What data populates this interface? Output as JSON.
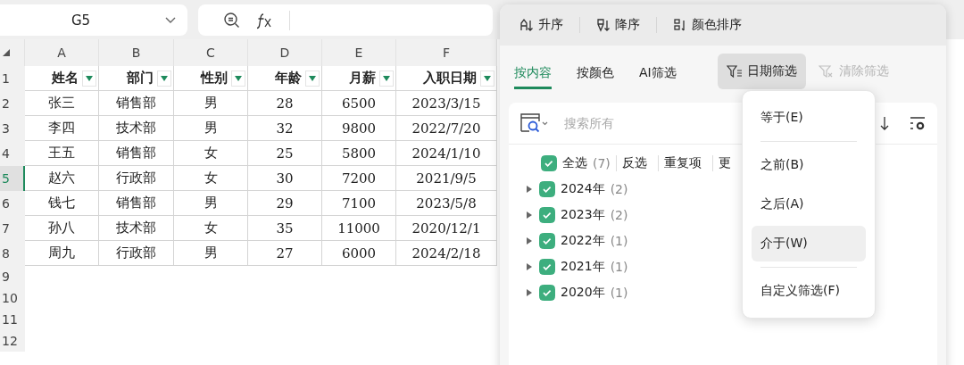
{
  "name_box": {
    "value": "G5"
  },
  "sheet": {
    "columns": [
      "A",
      "B",
      "C",
      "D",
      "E",
      "F"
    ],
    "header_row": {
      "number": "1",
      "cells": [
        "姓名",
        "部门",
        "性别",
        "年龄",
        "月薪",
        "入职日期"
      ]
    },
    "rows": [
      {
        "number": "2",
        "selected": false,
        "cells": [
          "张三",
          "销售部",
          "男",
          "28",
          "6500",
          "2023/3/15"
        ]
      },
      {
        "number": "3",
        "selected": false,
        "cells": [
          "李四",
          "技术部",
          "男",
          "32",
          "9800",
          "2022/7/20"
        ]
      },
      {
        "number": "4",
        "selected": false,
        "cells": [
          "王五",
          "销售部",
          "女",
          "25",
          "5800",
          "2024/1/10"
        ]
      },
      {
        "number": "5",
        "selected": true,
        "cells": [
          "赵六",
          "行政部",
          "女",
          "30",
          "7200",
          "2021/9/5"
        ]
      },
      {
        "number": "6",
        "selected": false,
        "cells": [
          "钱七",
          "销售部",
          "男",
          "29",
          "7100",
          "2023/5/8"
        ]
      },
      {
        "number": "7",
        "selected": false,
        "cells": [
          "孙八",
          "技术部",
          "女",
          "35",
          "11000",
          "2020/12/1"
        ]
      },
      {
        "number": "8",
        "selected": false,
        "cells": [
          "周九",
          "行政部",
          "男",
          "27",
          "6000",
          "2024/2/18"
        ]
      }
    ],
    "empty_rows": [
      "9",
      "10",
      "11",
      "12"
    ]
  },
  "filter_panel": {
    "sort_buttons": [
      {
        "kind": "ascending",
        "label": "升序"
      },
      {
        "kind": "descending",
        "label": "降序"
      },
      {
        "kind": "color",
        "label": "颜色排序"
      }
    ],
    "tabs": [
      {
        "label": "按内容",
        "selected": true
      },
      {
        "label": "按颜色",
        "selected": false
      },
      {
        "label": "AI筛选",
        "selected": false
      }
    ],
    "date_filter": {
      "label": "日期筛选",
      "pressed": true
    },
    "clear_filter": {
      "label": "清除筛选",
      "disabled": true
    },
    "search": {
      "placeholder": "搜索所有"
    },
    "select_all": {
      "label": "全选",
      "count": "(7)",
      "checked": true
    },
    "actions": [
      "反选",
      "重复项",
      "更"
    ],
    "tree": [
      {
        "label": "2024年",
        "count": "(2)",
        "checked": true,
        "expanded": false
      },
      {
        "label": "2023年",
        "count": "(2)",
        "checked": true,
        "expanded": false
      },
      {
        "label": "2022年",
        "count": "(1)",
        "checked": true,
        "expanded": false
      },
      {
        "label": "2021年",
        "count": "(1)",
        "checked": true,
        "expanded": false
      },
      {
        "label": "2020年",
        "count": "(1)",
        "checked": true,
        "expanded": false
      }
    ]
  },
  "date_menu": {
    "items": [
      {
        "kind": "item",
        "label": "等于(E)",
        "selected": false
      },
      {
        "kind": "separator"
      },
      {
        "kind": "item",
        "label": "之前(B)",
        "selected": false
      },
      {
        "kind": "item",
        "label": "之后(A)",
        "selected": false
      },
      {
        "kind": "item",
        "label": "介于(W)",
        "selected": true
      },
      {
        "kind": "separator"
      },
      {
        "kind": "item",
        "label": "自定义筛选(F)",
        "selected": false
      }
    ]
  }
}
